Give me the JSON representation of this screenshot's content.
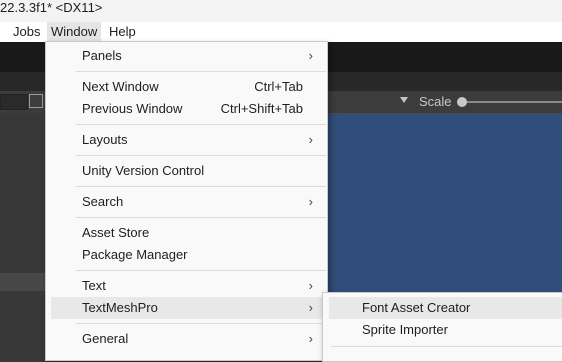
{
  "window": {
    "title": "22.3.3f1* <DX11>"
  },
  "menubar": {
    "items": [
      "Jobs",
      "Window",
      "Help"
    ],
    "active": "Window"
  },
  "window_menu": {
    "panels": "Panels",
    "next_window": "Next Window",
    "next_window_shortcut": "Ctrl+Tab",
    "previous_window": "Previous Window",
    "previous_window_shortcut": "Ctrl+Shift+Tab",
    "layouts": "Layouts",
    "unity_version_control": "Unity Version Control",
    "search": "Search",
    "asset_store": "Asset Store",
    "package_manager": "Package Manager",
    "text": "Text",
    "textmeshpro": "TextMeshPro",
    "general": "General"
  },
  "textmeshpro_submenu": {
    "font_asset_creator": "Font Asset Creator",
    "sprite_importer": "Sprite Importer"
  },
  "game_toolbar": {
    "scale_label": "Scale"
  },
  "icons": {
    "submenu_arrow": "chevron-right-icon",
    "scale_slider": "slider-knob"
  },
  "colors": {
    "game_view_bg": "#314d79",
    "menu_bg": "#f9f9f9",
    "highlight": "#e8e8e8"
  }
}
